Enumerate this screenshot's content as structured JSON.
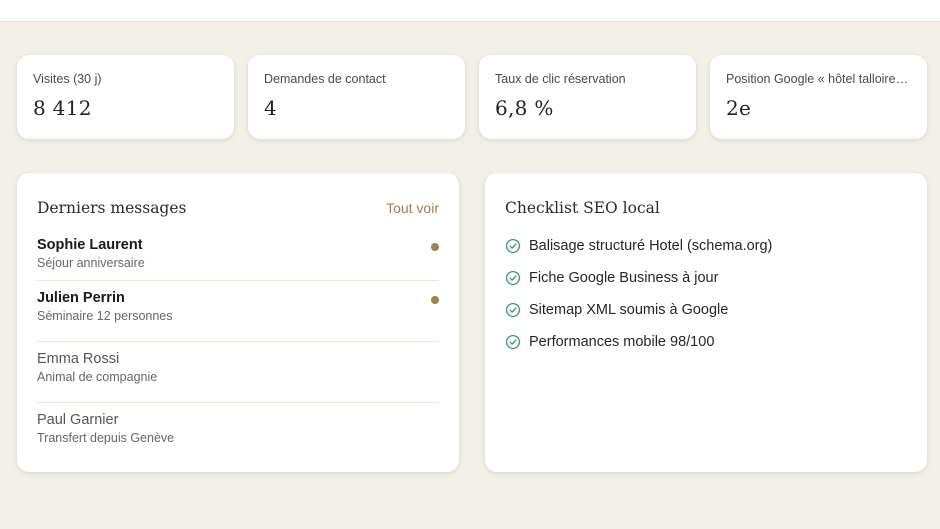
{
  "stats": [
    {
      "label": "Visites (30 j)",
      "value": "8 412"
    },
    {
      "label": "Demandes de contact",
      "value": "4"
    },
    {
      "label": "Taux de clic réservation",
      "value": "6,8 %"
    },
    {
      "label": "Position Google « hôtel talloires »",
      "value": "2e"
    }
  ],
  "messages": {
    "title": "Derniers messages",
    "see_all": "Tout voir",
    "items": [
      {
        "name": "Sophie Laurent",
        "subject": "Séjour anniversaire",
        "unread": true
      },
      {
        "name": "Julien Perrin",
        "subject": "Séminaire 12 personnes",
        "unread": true
      },
      {
        "name": "Emma Rossi",
        "subject": "Animal de compagnie",
        "unread": false
      },
      {
        "name": "Paul Garnier",
        "subject": "Transfert depuis Genève",
        "unread": false
      }
    ]
  },
  "checklist": {
    "title": "Checklist SEO local",
    "items": [
      {
        "label": "Balisage structuré Hotel (schema.org)",
        "icon": "check-circle-icon"
      },
      {
        "label": "Fiche Google Business à jour",
        "icon": "check-circle-icon"
      },
      {
        "label": "Sitemap XML soumis à Google",
        "icon": "check-circle-icon"
      },
      {
        "label": "Performances mobile 98/100",
        "icon": "check-circle-icon"
      }
    ]
  },
  "colors": {
    "accent": "#a0804d",
    "check": "#2e9a6a",
    "background": "#f3efe9"
  }
}
